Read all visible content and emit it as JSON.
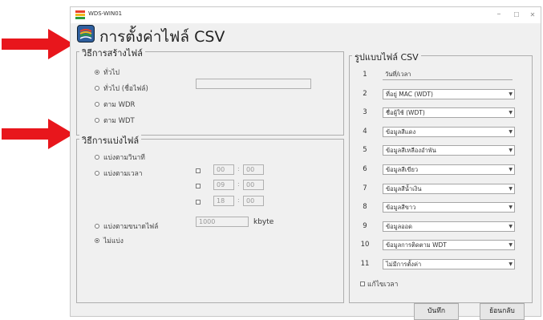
{
  "window": {
    "title": "WDS-WIN01",
    "controls": {
      "minimize": "–",
      "maximize": "☐",
      "close": "✕"
    }
  },
  "header": {
    "title": "การตั้งค่าไฟล์ CSV"
  },
  "create_method": {
    "legend": "วิธีการสร้างไฟล์",
    "options": [
      {
        "label": "ทั่วไป",
        "selected": true
      },
      {
        "label": "ทั่วไป (ชื่อไฟล์)",
        "selected": false
      },
      {
        "label": "ตาม WDR",
        "selected": false
      },
      {
        "label": "ตาม WDT",
        "selected": false
      }
    ],
    "filename_value": ""
  },
  "split_method": {
    "legend": "วิธีการแบ่งไฟล์",
    "by_minute": "แบ่งตามวินาที",
    "by_time": "แบ่งตามเวลา",
    "times": [
      {
        "hour": "00",
        "minute": "00"
      },
      {
        "hour": "09",
        "minute": "00"
      },
      {
        "hour": "18",
        "minute": "00"
      }
    ],
    "colon": ":",
    "by_size": "แบ่งตามขนาดไฟล์",
    "size_value": "1000",
    "size_unit": "kbyte",
    "no_split": "ไม่แบ่ง",
    "selected": "no_split"
  },
  "format": {
    "legend": "รูปแบบไฟล์ CSV",
    "rows": [
      {
        "num": "1",
        "value": "วันที่/เวลา"
      },
      {
        "num": "2",
        "value": "ที่อยู่ MAC (WDT)"
      },
      {
        "num": "3",
        "value": "ชื่อผู้ใช้ (WDT)"
      },
      {
        "num": "4",
        "value": "ข้อมูลสีแดง"
      },
      {
        "num": "5",
        "value": "ข้อมูลสีเหลืองอำพัน"
      },
      {
        "num": "6",
        "value": "ข้อมูลสีเขียว"
      },
      {
        "num": "7",
        "value": "ข้อมูลสีน้ำเงิน"
      },
      {
        "num": "8",
        "value": "ข้อมูลสีขาว"
      },
      {
        "num": "9",
        "value": "ข้อมูลออด"
      },
      {
        "num": "10",
        "value": "ข้อมูลการติดตาม WDT"
      },
      {
        "num": "11",
        "value": "ไม่มีการตั้งค่า"
      }
    ],
    "edit_time": "แก้ไขเวลา",
    "dropdown_arrow": "▼"
  },
  "buttons": {
    "save": "บันทึก",
    "back": "ย้อนกลับ"
  },
  "colors": {
    "arrow": "#e8161c",
    "window_bg": "#f0f0f0",
    "header_icon": "#2f5f9e"
  }
}
